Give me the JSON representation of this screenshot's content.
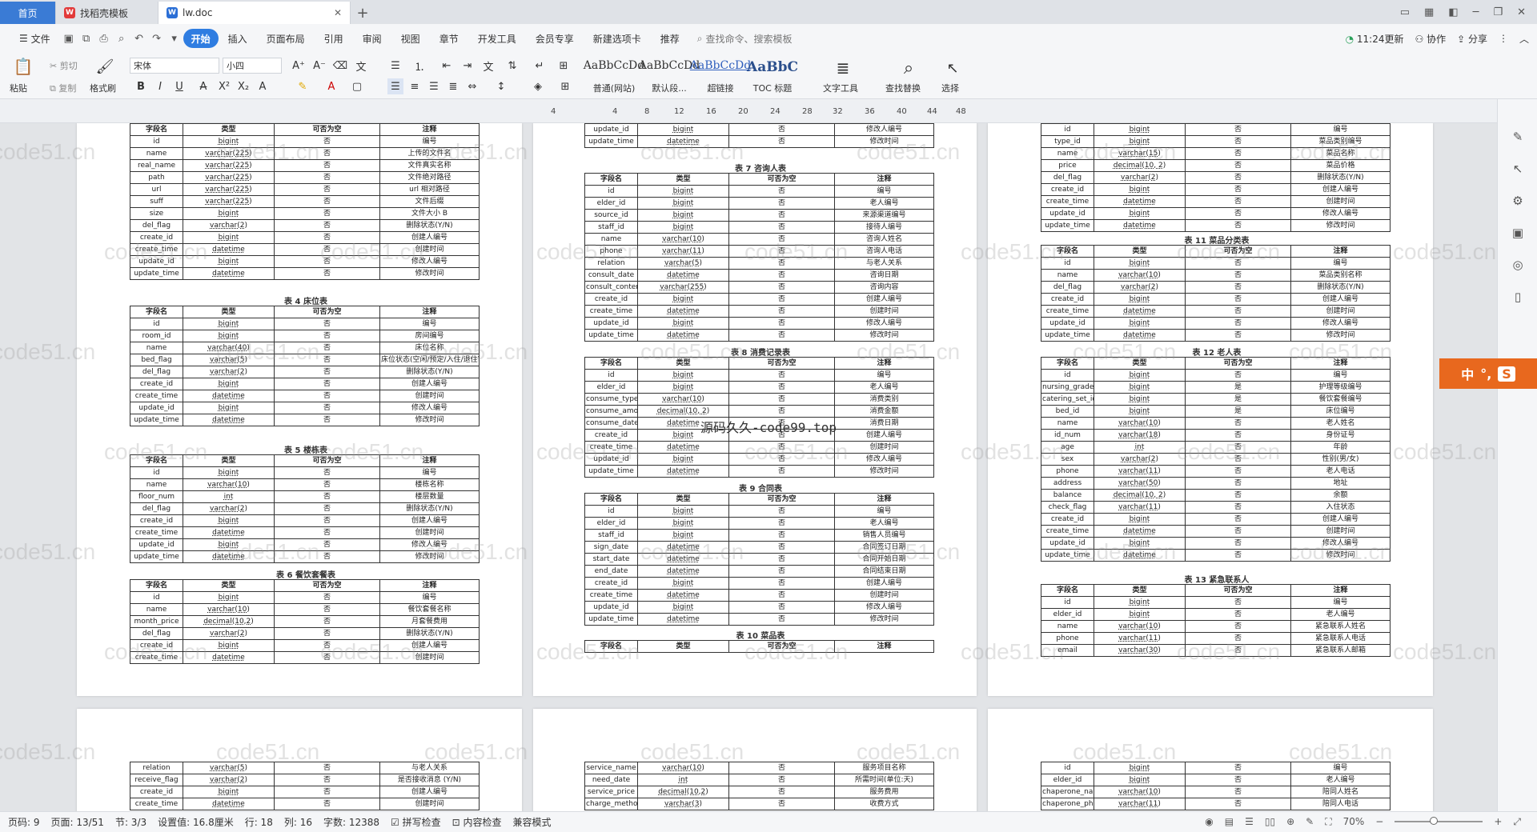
{
  "tabs": {
    "home": "首页",
    "templates": "找稻壳模板",
    "doc": "lw.doc"
  },
  "menu": {
    "file": "文件",
    "items": [
      "开始",
      "插入",
      "页面布局",
      "引用",
      "审阅",
      "视图",
      "章节",
      "开发工具",
      "会员专享",
      "新建选项卡",
      "推荐"
    ],
    "search_placeholder": "查找命令、搜索模板",
    "update": "11:24更新",
    "collab": "协作",
    "share": "分享"
  },
  "ribbon": {
    "paste": "粘贴",
    "cut": "剪切",
    "copy": "复制",
    "format_painter": "格式刷",
    "font_name": "宋体",
    "font_size": "小四",
    "styles": [
      {
        "sample": "AaBbCcDd",
        "label": "普通(网站)"
      },
      {
        "sample": "AaBbCcDd",
        "label": "默认段..."
      },
      {
        "sample": "AaBbCcDd",
        "label": "超链接"
      },
      {
        "sample": "AaBbC",
        "label": "TOC 标题"
      }
    ],
    "text_tools": "文字工具",
    "find_replace": "查找替换",
    "select": "选择"
  },
  "ruler_ticks": [
    "4",
    "4",
    "8",
    "12",
    "16",
    "20",
    "24",
    "28",
    "32",
    "36",
    "40",
    "44",
    "48"
  ],
  "watermark": "code51.cn",
  "center_watermark": "源码久久-code99.top",
  "tables": [
    {
      "id": "p1t0",
      "caption": "",
      "header": [
        "字段名",
        "类型",
        "可否为空",
        "注释"
      ],
      "rows": [
        [
          "id",
          "bigint",
          "否",
          "编号"
        ],
        [
          "name",
          "varchar(225)",
          "否",
          "上传的文件名"
        ],
        [
          "real_name",
          "varchar(225)",
          "否",
          "文件真实名称"
        ],
        [
          "path",
          "varchar(225)",
          "否",
          "文件绝对路径"
        ],
        [
          "url",
          "varchar(225)",
          "否",
          "url 相对路径"
        ],
        [
          "suff",
          "varchar(225)",
          "否",
          "文件后缀"
        ],
        [
          "size",
          "bigint",
          "否",
          "文件大小 B"
        ],
        [
          "del_flag",
          "varchar(2)",
          "否",
          "删除状态(Y/N)"
        ],
        [
          "create_id",
          "bigint",
          "否",
          "创建人编号"
        ],
        [
          "create_time",
          "datetime",
          "否",
          "创建时间"
        ],
        [
          "update_id",
          "bigint",
          "否",
          "修改人编号"
        ],
        [
          "update_time",
          "datetime",
          "否",
          "修改时间"
        ]
      ]
    },
    {
      "id": "p1t1",
      "caption": "表 4 床位表",
      "header": [
        "字段名",
        "类型",
        "可否为空",
        "注释"
      ],
      "rows": [
        [
          "id",
          "bigint",
          "否",
          "编号"
        ],
        [
          "room_id",
          "bigint",
          "否",
          "房间编号"
        ],
        [
          "name",
          "varchar(40)",
          "否",
          "床位名称"
        ],
        [
          "bed_flag",
          "varchar(5)",
          "否",
          "床位状态(空闲/预定/入住/退住审核)"
        ],
        [
          "del_flag",
          "varchar(2)",
          "否",
          "删除状态(Y/N)"
        ],
        [
          "create_id",
          "bigint",
          "否",
          "创建人编号"
        ],
        [
          "create_time",
          "datetime",
          "否",
          "创建时间"
        ],
        [
          "update_id",
          "bigint",
          "否",
          "修改人编号"
        ],
        [
          "update_time",
          "datetime",
          "否",
          "修改时间"
        ]
      ]
    },
    {
      "id": "p1t2",
      "caption": "表 5 楼栋表",
      "header": [
        "字段名",
        "类型",
        "可否为空",
        "注释"
      ],
      "rows": [
        [
          "id",
          "bigint",
          "否",
          "编号"
        ],
        [
          "name",
          "varchar(10)",
          "否",
          "楼栋名称"
        ],
        [
          "floor_num",
          "int",
          "否",
          "楼层数量"
        ],
        [
          "del_flag",
          "varchar(2)",
          "否",
          "删除状态(Y/N)"
        ],
        [
          "create_id",
          "bigint",
          "否",
          "创建人编号"
        ],
        [
          "create_time",
          "datetime",
          "否",
          "创建时间"
        ],
        [
          "update_id",
          "bigint",
          "否",
          "修改人编号"
        ],
        [
          "update_time",
          "datetime",
          "否",
          "修改时间"
        ]
      ]
    },
    {
      "id": "p1t3",
      "caption": "表 6 餐饮套餐表",
      "header": [
        "字段名",
        "类型",
        "可否为空",
        "注释"
      ],
      "rows": [
        [
          "id",
          "bigint",
          "否",
          "编号"
        ],
        [
          "name",
          "varchar(10)",
          "否",
          "餐饮套餐名称"
        ],
        [
          "month_price",
          "decimal(10,2)",
          "否",
          "月套餐费用"
        ],
        [
          "del_flag",
          "varchar(2)",
          "否",
          "删除状态(Y/N)"
        ],
        [
          "create_id",
          "bigint",
          "否",
          "创建人编号"
        ],
        [
          "create_time",
          "datetime",
          "否",
          "创建时间"
        ]
      ]
    },
    {
      "id": "p2t0",
      "caption": "",
      "header": null,
      "rows": [
        [
          "update_id",
          "bigint",
          "否",
          "修改人编号"
        ],
        [
          "update_time",
          "datetime",
          "否",
          "修改时间"
        ]
      ]
    },
    {
      "id": "p2t1",
      "caption": "表 7 咨询人表",
      "header": [
        "字段名",
        "类型",
        "可否为空",
        "注释"
      ],
      "rows": [
        [
          "id",
          "bigint",
          "否",
          "编号"
        ],
        [
          "elder_id",
          "bigint",
          "否",
          "老人编号"
        ],
        [
          "source_id",
          "bigint",
          "否",
          "来源渠道编号"
        ],
        [
          "staff_id",
          "bigint",
          "否",
          "接待人编号"
        ],
        [
          "name",
          "varchar(10)",
          "否",
          "咨询人姓名"
        ],
        [
          "phone",
          "varchar(11)",
          "否",
          "咨询人电话"
        ],
        [
          "relation",
          "varchar(5)",
          "否",
          "与老人关系"
        ],
        [
          "consult_date",
          "datetime",
          "否",
          "咨询日期"
        ],
        [
          "consult_content",
          "varchar(255)",
          "否",
          "咨询内容"
        ],
        [
          "create_id",
          "bigint",
          "否",
          "创建人编号"
        ],
        [
          "create_time",
          "datetime",
          "否",
          "创建时间"
        ],
        [
          "update_id",
          "bigint",
          "否",
          "修改人编号"
        ],
        [
          "update_time",
          "datetime",
          "否",
          "修改时间"
        ]
      ]
    },
    {
      "id": "p2t2",
      "caption": "表 8 消费记录表",
      "header": [
        "字段名",
        "类型",
        "可否为空",
        "注释"
      ],
      "rows": [
        [
          "id",
          "bigint",
          "否",
          "编号"
        ],
        [
          "elder_id",
          "bigint",
          "否",
          "老人编号"
        ],
        [
          "consume_type",
          "varchar(10)",
          "否",
          "消费类别"
        ],
        [
          "consume_amount",
          "decimal(10, 2)",
          "否",
          "消费金额"
        ],
        [
          "consume_date",
          "datetime",
          "否",
          "消费日期"
        ],
        [
          "create_id",
          "bigint",
          "否",
          "创建人编号"
        ],
        [
          "create_time",
          "datetime",
          "否",
          "创建时间"
        ],
        [
          "update_id",
          "bigint",
          "否",
          "修改人编号"
        ],
        [
          "update_time",
          "datetime",
          "否",
          "修改时间"
        ]
      ]
    },
    {
      "id": "p2t3",
      "caption": "表 9 合同表",
      "header": [
        "字段名",
        "类型",
        "可否为空",
        "注释"
      ],
      "rows": [
        [
          "id",
          "bigint",
          "否",
          "编号"
        ],
        [
          "elder_id",
          "bigint",
          "否",
          "老人编号"
        ],
        [
          "staff_id",
          "bigint",
          "否",
          "销售人员编号"
        ],
        [
          "sign_date",
          "datetime",
          "否",
          "合同签订日期"
        ],
        [
          "start_date",
          "datetime",
          "否",
          "合同开始日期"
        ],
        [
          "end_date",
          "datetime",
          "否",
          "合同结束日期"
        ],
        [
          "create_id",
          "bigint",
          "否",
          "创建人编号"
        ],
        [
          "create_time",
          "datetime",
          "否",
          "创建时间"
        ],
        [
          "update_id",
          "bigint",
          "否",
          "修改人编号"
        ],
        [
          "update_time",
          "datetime",
          "否",
          "修改时间"
        ]
      ]
    },
    {
      "id": "p2t4",
      "caption": "表 10 菜品表",
      "header": [
        "字段名",
        "类型",
        "可否为空",
        "注释"
      ],
      "rows": []
    },
    {
      "id": "p3t0",
      "caption": "",
      "header": null,
      "rows": [
        [
          "id",
          "bigint",
          "否",
          "编号"
        ],
        [
          "type_id",
          "bigint",
          "否",
          "菜品类别编号"
        ],
        [
          "name",
          "varchar(15)",
          "否",
          "菜品名称"
        ],
        [
          "price",
          "decimal(10, 2)",
          "否",
          "菜品价格"
        ],
        [
          "del_flag",
          "varchar(2)",
          "否",
          "删除状态(Y/N)"
        ],
        [
          "create_id",
          "bigint",
          "否",
          "创建人编号"
        ],
        [
          "create_time",
          "datetime",
          "否",
          "创建时间"
        ],
        [
          "update_id",
          "bigint",
          "否",
          "修改人编号"
        ],
        [
          "update_time",
          "datetime",
          "否",
          "修改时间"
        ]
      ]
    },
    {
      "id": "p3t1",
      "caption": "表 11 菜品分类表",
      "header": [
        "字段名",
        "类型",
        "可否为空",
        "注释"
      ],
      "rows": [
        [
          "id",
          "bigint",
          "否",
          "编号"
        ],
        [
          "name",
          "varchar(10)",
          "否",
          "菜品类别名称"
        ],
        [
          "del_flag",
          "varchar(2)",
          "否",
          "删除状态(Y/N)"
        ],
        [
          "create_id",
          "bigint",
          "否",
          "创建人编号"
        ],
        [
          "create_time",
          "datetime",
          "否",
          "创建时间"
        ],
        [
          "update_id",
          "bigint",
          "否",
          "修改人编号"
        ],
        [
          "update_time",
          "datetime",
          "否",
          "修改时间"
        ]
      ]
    },
    {
      "id": "p3t2",
      "caption": "表 12 老人表",
      "header": [
        "字段名",
        "类型",
        "可否为空",
        "注释"
      ],
      "rows": [
        [
          "id",
          "bigint",
          "否",
          "编号"
        ],
        [
          "nursing_grade_id",
          "bigint",
          "是",
          "护理等级编号"
        ],
        [
          "catering_set_id",
          "bigint",
          "是",
          "餐饮套餐编号"
        ],
        [
          "bed_id",
          "bigint",
          "是",
          "床位编号"
        ],
        [
          "name",
          "varchar(10)",
          "否",
          "老人姓名"
        ],
        [
          "id_num",
          "varchar(18)",
          "否",
          "身份证号"
        ],
        [
          "age",
          "int",
          "否",
          "年龄"
        ],
        [
          "sex",
          "varchar(2)",
          "否",
          "性别(男/女)"
        ],
        [
          "phone",
          "varchar(11)",
          "否",
          "老人电话"
        ],
        [
          "address",
          "varchar(50)",
          "否",
          "地址"
        ],
        [
          "balance",
          "decimal(10, 2)",
          "否",
          "余额"
        ],
        [
          "check_flag",
          "varchar(11)",
          "否",
          "入住状态"
        ],
        [
          "create_id",
          "bigint",
          "否",
          "创建人编号"
        ],
        [
          "create_time",
          "datetime",
          "否",
          "创建时间"
        ],
        [
          "update_id",
          "bigint",
          "否",
          "修改人编号"
        ],
        [
          "update_time",
          "datetime",
          "否",
          "修改时间"
        ]
      ]
    },
    {
      "id": "p3t3",
      "caption": "表 13 紧急联系人",
      "header": [
        "字段名",
        "类型",
        "可否为空",
        "注释"
      ],
      "rows": [
        [
          "id",
          "bigint",
          "否",
          "编号"
        ],
        [
          "elder_id",
          "bigint",
          "否",
          "老人编号"
        ],
        [
          "name",
          "varchar(10)",
          "否",
          "紧急联系人姓名"
        ],
        [
          "phone",
          "varchar(11)",
          "否",
          "紧急联系人电话"
        ],
        [
          "email",
          "varchar(30)",
          "否",
          "紧急联系人邮箱"
        ]
      ]
    },
    {
      "id": "p4t0",
      "caption": "",
      "header": null,
      "rows": [
        [
          "relation",
          "varchar(5)",
          "否",
          "与老人关系"
        ],
        [
          "receive_flag",
          "varchar(2)",
          "否",
          "是否接收消息 (Y/N)"
        ],
        [
          "create_id",
          "bigint",
          "否",
          "创建人编号"
        ],
        [
          "create_time",
          "datetime",
          "否",
          "创建时间"
        ]
      ]
    },
    {
      "id": "p5t0",
      "caption": "",
      "header": null,
      "rows": [
        [
          "service_name",
          "varchar(10)",
          "否",
          "服务项目名称"
        ],
        [
          "need_date",
          "int",
          "否",
          "所需时间(单位:天)"
        ],
        [
          "service_price",
          "decimal(10,2)",
          "否",
          "服务费用"
        ],
        [
          "charge_method",
          "varchar(3)",
          "否",
          "收费方式"
        ]
      ]
    },
    {
      "id": "p6t0",
      "caption": "",
      "header": null,
      "rows": [
        [
          "id",
          "bigint",
          "否",
          "编号"
        ],
        [
          "elder_id",
          "bigint",
          "否",
          "老人编号"
        ],
        [
          "chaperone_name",
          "varchar(10)",
          "否",
          "陪同人姓名"
        ],
        [
          "chaperone_phone",
          "varchar(11)",
          "否",
          "陪同人电话"
        ]
      ]
    }
  ],
  "ime": {
    "label": "中",
    "extra": "°,"
  },
  "status": {
    "page_num": "页码: 9",
    "page": "页面: 13/51",
    "section": "节: 3/3",
    "setting": "设置值: 16.8厘米",
    "row": "行: 18",
    "col": "列: 16",
    "words": "字数: 12388",
    "spell": "拼写检查",
    "content_check": "内容检查",
    "compat": "兼容模式",
    "zoom": "70%"
  },
  "colors": {
    "accent": "#2f7de1",
    "home_tab": "#3a7bd5",
    "ime": "#e8681e"
  }
}
